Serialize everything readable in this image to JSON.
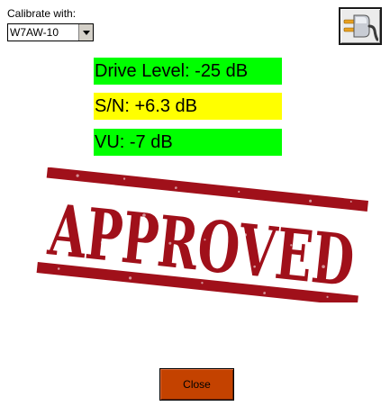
{
  "calibrate": {
    "label": "Calibrate with:",
    "selected": "W7AW-10"
  },
  "plug_button": {
    "icon": "plug-connect-icon"
  },
  "meters": {
    "drive": {
      "text": "Drive Level: -25 dB",
      "color": "#00ff00"
    },
    "snr": {
      "text": "S/N: +6.3 dB",
      "color": "#ffff00"
    },
    "vu": {
      "text": "VU: -7 dB",
      "color": "#00ff00"
    }
  },
  "stamp": {
    "text": "APPROVED",
    "color": "#a0101a"
  },
  "close_button": {
    "label": "Close",
    "color": "#c44200"
  }
}
